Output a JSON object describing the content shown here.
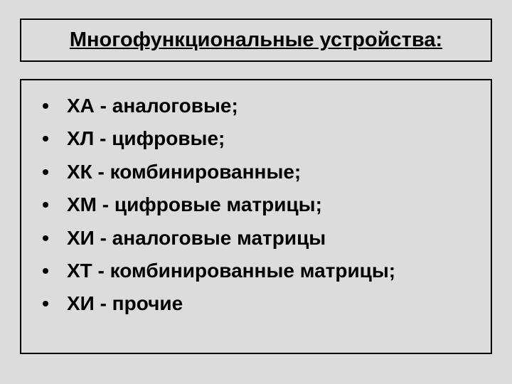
{
  "title": "Многофункциональные устройства:",
  "items": [
    "ХА - аналоговые;",
    "ХЛ - цифровые;",
    "ХК - комбинированные;",
    "ХМ - цифровые матрицы;",
    "ХИ - аналоговые матрицы",
    "ХТ - комбинированные матрицы;",
    "ХИ - прочие"
  ]
}
